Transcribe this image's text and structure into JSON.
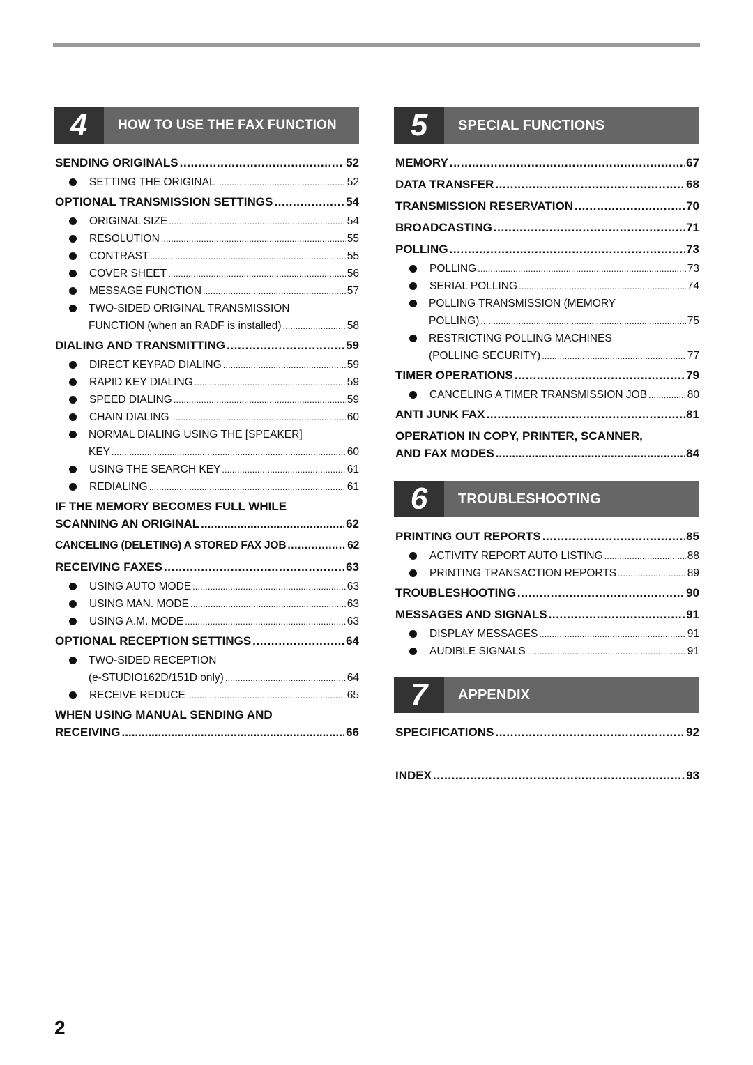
{
  "page_number": "2",
  "colors": {
    "chapter_bar": "#666666",
    "chapter_number_box": "#333333",
    "top_rule": "#9a9a9a"
  },
  "chapters": {
    "c4": {
      "number": "4",
      "title": "HOW TO USE THE FAX FUNCTION",
      "sending_originals": {
        "label": "SENDING ORIGINALS",
        "page": "52",
        "subs": [
          {
            "label": "SETTING THE ORIGINAL",
            "page": "52"
          }
        ]
      },
      "optional_transmission": {
        "label": "OPTIONAL TRANSMISSION SETTINGS",
        "page": "54",
        "subs": [
          {
            "label": "ORIGINAL SIZE",
            "page": "54"
          },
          {
            "label": "RESOLUTION",
            "page": "55"
          },
          {
            "label": "CONTRAST",
            "page": "55"
          },
          {
            "label": "COVER SHEET",
            "page": "56"
          },
          {
            "label": "MESSAGE FUNCTION",
            "page": "57"
          },
          {
            "line1": "TWO-SIDED ORIGINAL TRANSMISSION",
            "label": "FUNCTION (when an RADF is installed)",
            "page": "58"
          }
        ]
      },
      "dialing": {
        "label": "DIALING AND TRANSMITTING",
        "page": "59",
        "subs": [
          {
            "label": "DIRECT KEYPAD DIALING",
            "page": "59"
          },
          {
            "label": "RAPID KEY DIALING",
            "page": "59"
          },
          {
            "label": "SPEED DIALING",
            "page": "59"
          },
          {
            "label": "CHAIN DIALING",
            "page": "60"
          },
          {
            "line1": "NORMAL DIALING USING THE [SPEAKER]",
            "label": "KEY",
            "page": "60"
          },
          {
            "label": "USING THE SEARCH KEY",
            "page": "61"
          },
          {
            "label": "REDIALING",
            "page": "61"
          }
        ]
      },
      "memory_full": {
        "line1": "IF THE MEMORY BECOMES FULL WHILE",
        "label": "SCANNING AN ORIGINAL",
        "page": "62"
      },
      "canceling": {
        "label": "CANCELING (DELETING) A STORED FAX JOB",
        "page": "62"
      },
      "receiving": {
        "label": "RECEIVING FAXES",
        "page": "63",
        "subs": [
          {
            "label": "USING AUTO MODE",
            "page": "63"
          },
          {
            "label": "USING MAN. MODE",
            "page": "63"
          },
          {
            "label": "USING A.M. MODE",
            "page": "63"
          }
        ]
      },
      "optional_reception": {
        "label": "OPTIONAL RECEPTION SETTINGS",
        "page": "64",
        "subs": [
          {
            "line1": "TWO-SIDED RECEPTION",
            "label": "(e-STUDIO162D/151D only)",
            "page": "64"
          },
          {
            "label": "RECEIVE REDUCE",
            "page": "65"
          }
        ]
      },
      "manual": {
        "line1": "WHEN USING MANUAL SENDING AND",
        "label": "RECEIVING",
        "page": "66"
      }
    },
    "c5": {
      "number": "5",
      "title": "SPECIAL FUNCTIONS",
      "memory": {
        "label": "MEMORY",
        "page": "67"
      },
      "data_transfer": {
        "label": "DATA TRANSFER",
        "page": "68"
      },
      "reservation": {
        "label": "TRANSMISSION RESERVATION",
        "page": "70"
      },
      "broadcasting": {
        "label": "BROADCASTING",
        "page": "71"
      },
      "polling": {
        "label": "POLLING",
        "page": "73",
        "subs": [
          {
            "label": "POLLING",
            "page": "73"
          },
          {
            "label": "SERIAL POLLING",
            "page": "74"
          },
          {
            "line1": "POLLING TRANSMISSION (MEMORY",
            "label": "POLLING)",
            "page": "75"
          },
          {
            "line1": "RESTRICTING POLLING MACHINES",
            "label": "(POLLING SECURITY)",
            "page": "77"
          }
        ]
      },
      "timer": {
        "label": "TIMER OPERATIONS",
        "page": "79",
        "subs": [
          {
            "label": "CANCELING A TIMER TRANSMISSION JOB",
            "page": "80"
          }
        ]
      },
      "anti_junk": {
        "label": "ANTI JUNK FAX",
        "page": "81"
      },
      "operation": {
        "line1": "OPERATION IN COPY, PRINTER, SCANNER,",
        "label": "AND FAX MODES",
        "page": "84"
      }
    },
    "c6": {
      "number": "6",
      "title": "TROUBLESHOOTING",
      "printing_reports": {
        "label": "PRINTING OUT REPORTS",
        "page": "85",
        "subs": [
          {
            "label": "ACTIVITY REPORT AUTO LISTING",
            "page": "88"
          },
          {
            "label": "PRINTING TRANSACTION REPORTS",
            "page": "89"
          }
        ]
      },
      "troubleshooting": {
        "label": "TROUBLESHOOTING",
        "page": "90"
      },
      "messages": {
        "label": "MESSAGES AND SIGNALS",
        "page": "91",
        "subs": [
          {
            "label": "DISPLAY MESSAGES",
            "page": "91"
          },
          {
            "label": "AUDIBLE SIGNALS",
            "page": "91"
          }
        ]
      }
    },
    "c7": {
      "number": "7",
      "title": "APPENDIX",
      "specifications": {
        "label": "SPECIFICATIONS",
        "page": "92"
      },
      "index": {
        "label": "INDEX",
        "page": "93"
      }
    }
  }
}
